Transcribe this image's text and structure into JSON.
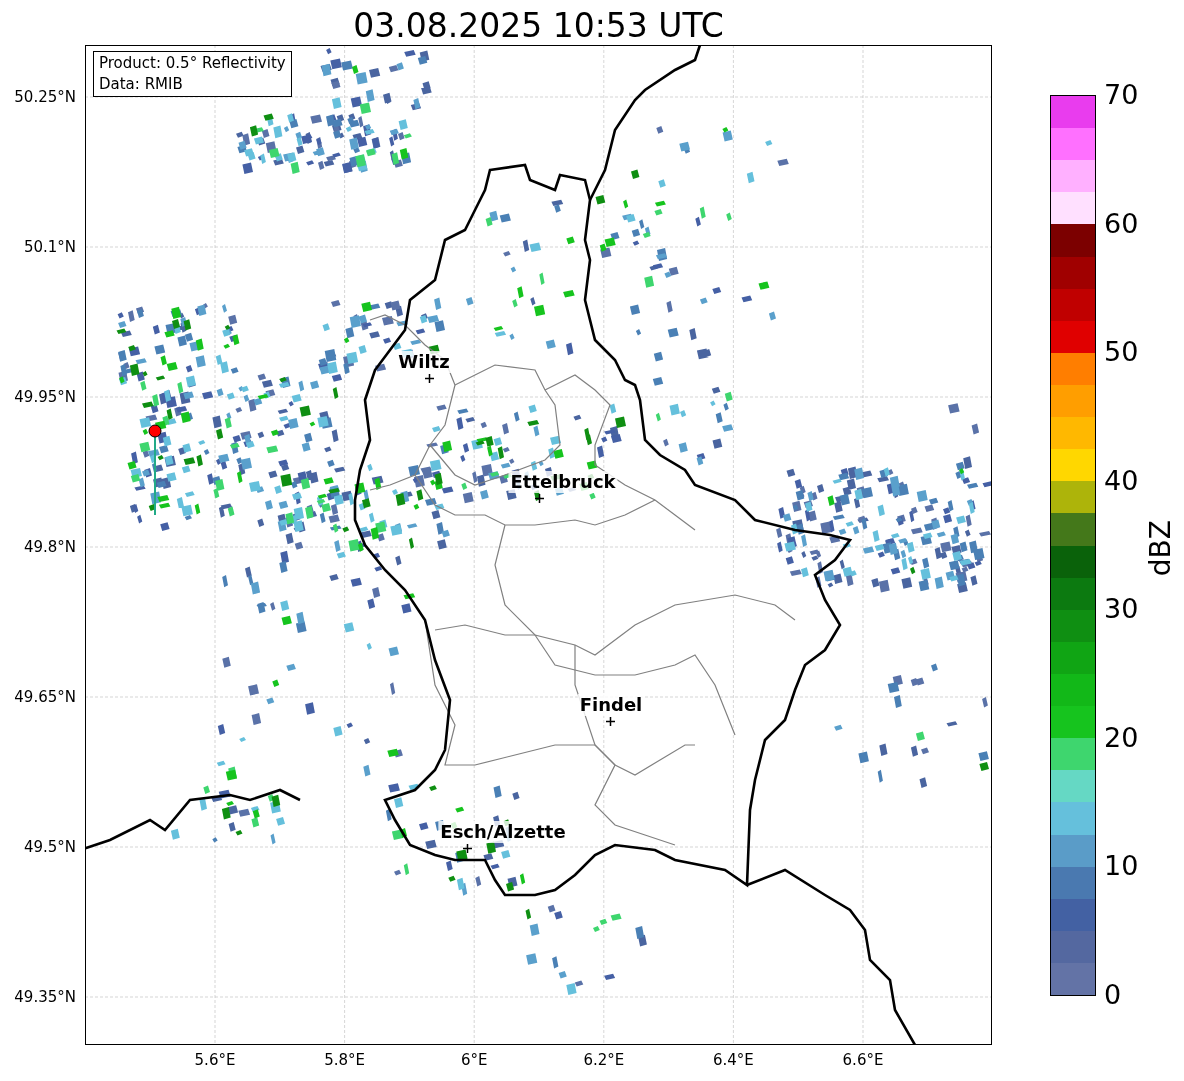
{
  "title": "03.08.2025 10:53 UTC",
  "info_box": {
    "lines": [
      "Product: 0.5° Reflectivity",
      "Data: RMIB"
    ]
  },
  "map": {
    "yticks": [
      "50.25°N",
      "50.1°N",
      "49.95°N",
      "49.8°N",
      "49.65°N",
      "49.5°N",
      "49.35°N"
    ],
    "xticks": [
      "5.6°E",
      "5.8°E",
      "6°E",
      "6.2°E",
      "6.4°E",
      "6.6°E"
    ],
    "cities": [
      {
        "name": "Wiltz"
      },
      {
        "name": "Ettelbruck"
      },
      {
        "name": "Findel"
      },
      {
        "name": "Esch/Alzette"
      }
    ]
  },
  "colorbar": {
    "label": "dBZ",
    "ticks": [
      "70",
      "60",
      "50",
      "40",
      "30",
      "20",
      "10",
      "0"
    ],
    "colors": [
      {
        "color": "#e93cee"
      },
      {
        "color": "#ff70ff"
      },
      {
        "color": "#ffb0ff"
      },
      {
        "color": "#ffe0ff"
      },
      {
        "color": "#7c0000"
      },
      {
        "color": "#a00000"
      },
      {
        "color": "#c00000"
      },
      {
        "color": "#e00000"
      },
      {
        "color": "#ff7e00"
      },
      {
        "color": "#ff9e00"
      },
      {
        "color": "#ffb800"
      },
      {
        "color": "#ffd700"
      },
      {
        "color": "#adb40a"
      },
      {
        "color": "#44781a"
      },
      {
        "color": "#0a620a"
      },
      {
        "color": "#0c7a10"
      },
      {
        "color": "#0f8f12"
      },
      {
        "color": "#10a514"
      },
      {
        "color": "#12b818"
      },
      {
        "color": "#16c41e"
      },
      {
        "color": "#3ed66e"
      },
      {
        "color": "#65d8c4"
      },
      {
        "color": "#65c0dc"
      },
      {
        "color": "#5a9cc8"
      },
      {
        "color": "#4a79b0"
      },
      {
        "color": "#4361a3"
      },
      {
        "color": "#5468a0"
      },
      {
        "color": "#6373a6"
      }
    ]
  }
}
